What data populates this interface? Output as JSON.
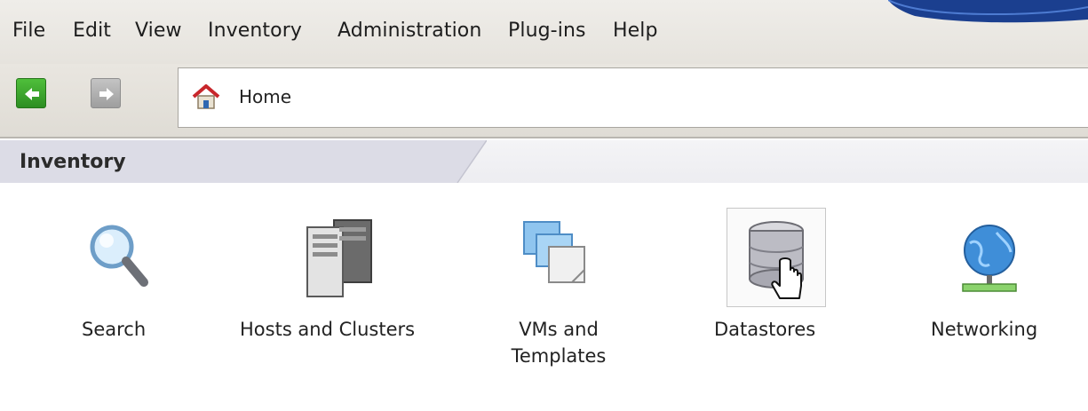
{
  "menu": {
    "items": [
      "File",
      "Edit",
      "View",
      "Inventory",
      "Administration",
      "Plug-ins",
      "Help"
    ]
  },
  "toolbar": {
    "address_crumb": "Home"
  },
  "panel": {
    "title": "Inventory"
  },
  "tiles": [
    {
      "label": "Search",
      "icon": "magnifier-icon"
    },
    {
      "label": "Hosts and Clusters",
      "icon": "servers-icon"
    },
    {
      "label_line1": "VMs and",
      "label_line2": "Templates",
      "icon": "vms-templates-icon"
    },
    {
      "label": "Datastores",
      "icon": "database-icon",
      "selected": true
    },
    {
      "label": "Networking",
      "icon": "globe-network-icon"
    }
  ],
  "colors": {
    "menubar_bg": "#e8e5df",
    "back_button": "#3aa52c",
    "forward_button": "#b0b0b0",
    "brand_accent": "#1b3f8f",
    "panel_header_bg": "#efeff2"
  }
}
